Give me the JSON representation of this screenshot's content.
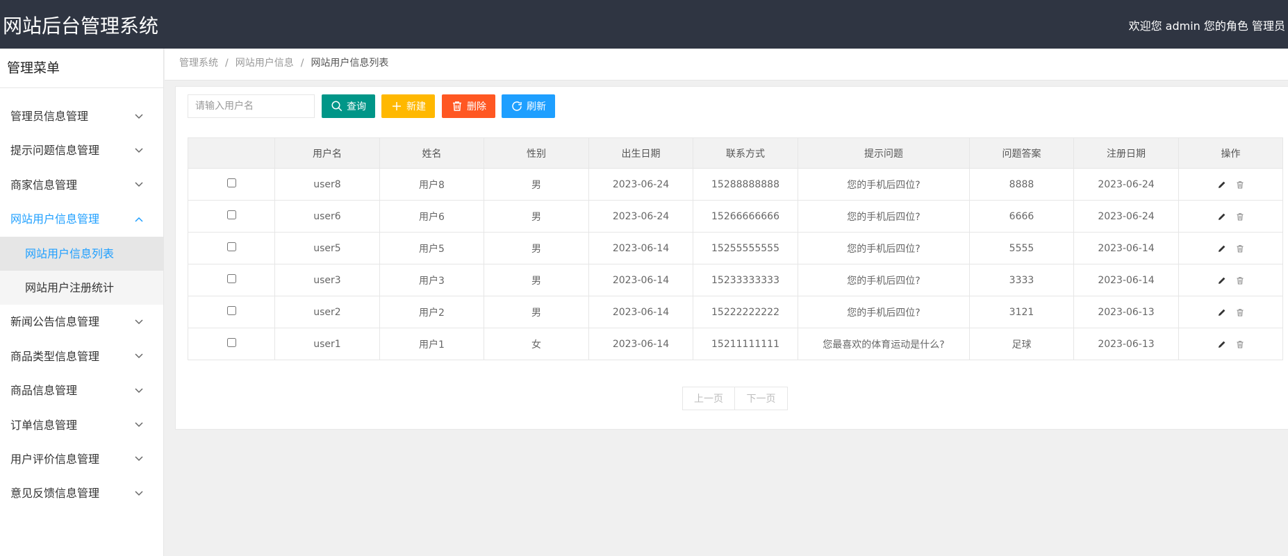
{
  "header": {
    "title": "网站后台管理系统",
    "welcome": "欢迎您 admin 您的角色 管理员"
  },
  "sidebar": {
    "title": "管理菜单",
    "items": [
      {
        "label": "管理员信息管理",
        "icon": "chevron-down-icon"
      },
      {
        "label": "提示问题信息管理",
        "icon": "chevron-down-icon"
      },
      {
        "label": "商家信息管理",
        "icon": "chevron-down-icon"
      },
      {
        "label": "网站用户信息管理",
        "icon": "chevron-up-icon",
        "open": true,
        "children": [
          {
            "label": "网站用户信息列表",
            "active": true
          },
          {
            "label": "网站用户注册统计"
          }
        ]
      },
      {
        "label": "新闻公告信息管理",
        "icon": "chevron-down-icon"
      },
      {
        "label": "商品类型信息管理",
        "icon": "chevron-down-icon"
      },
      {
        "label": "商品信息管理",
        "icon": "chevron-down-icon"
      },
      {
        "label": "订单信息管理",
        "icon": "chevron-down-icon"
      },
      {
        "label": "用户评价信息管理",
        "icon": "chevron-down-icon"
      },
      {
        "label": "意见反馈信息管理",
        "icon": "chevron-down-icon"
      }
    ]
  },
  "breadcrumb": {
    "items": [
      "管理系统",
      "网站用户信息",
      "网站用户信息列表"
    ],
    "separator": "/"
  },
  "toolbar": {
    "search_placeholder": "请输入用户名",
    "query_label": "查询",
    "new_label": "新建",
    "delete_label": "删除",
    "refresh_label": "刷新"
  },
  "table": {
    "columns": [
      "",
      "用户名",
      "姓名",
      "性别",
      "出生日期",
      "联系方式",
      "提示问题",
      "问题答案",
      "注册日期",
      "操作"
    ],
    "rows": [
      {
        "username": "user8",
        "name": "用户8",
        "gender": "男",
        "birth": "2023-06-24",
        "phone": "15288888888",
        "question": "您的手机后四位?",
        "answer": "8888",
        "reg_date": "2023-06-24"
      },
      {
        "username": "user6",
        "name": "用户6",
        "gender": "男",
        "birth": "2023-06-24",
        "phone": "15266666666",
        "question": "您的手机后四位?",
        "answer": "6666",
        "reg_date": "2023-06-24"
      },
      {
        "username": "user5",
        "name": "用户5",
        "gender": "男",
        "birth": "2023-06-14",
        "phone": "15255555555",
        "question": "您的手机后四位?",
        "answer": "5555",
        "reg_date": "2023-06-14"
      },
      {
        "username": "user3",
        "name": "用户3",
        "gender": "男",
        "birth": "2023-06-14",
        "phone": "15233333333",
        "question": "您的手机后四位?",
        "answer": "3333",
        "reg_date": "2023-06-14"
      },
      {
        "username": "user2",
        "name": "用户2",
        "gender": "男",
        "birth": "2023-06-14",
        "phone": "15222222222",
        "question": "您的手机后四位?",
        "answer": "3121",
        "reg_date": "2023-06-13"
      },
      {
        "username": "user1",
        "name": "用户1",
        "gender": "女",
        "birth": "2023-06-14",
        "phone": "15211111111",
        "question": "您最喜欢的体育运动是什么?",
        "answer": "足球",
        "reg_date": "2023-06-13"
      }
    ]
  },
  "pager": {
    "prev_label": "上一页",
    "next_label": "下一页"
  },
  "colors": {
    "header_bg": "#2f3542",
    "accent": "#1e9fff",
    "query": "#009688",
    "new": "#ffb800",
    "delete": "#ff5722",
    "refresh": "#1e9fff"
  }
}
